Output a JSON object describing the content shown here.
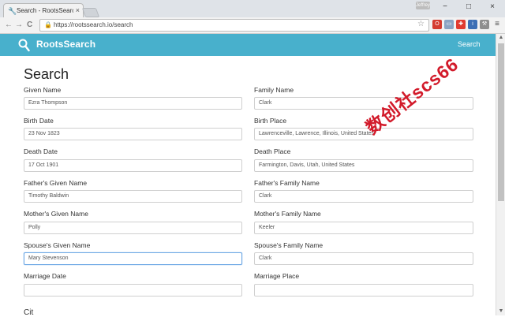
{
  "browser": {
    "tab_title": "Search - RootsSearch",
    "tab_favicon": "wrench-icon",
    "url": "https://rootssearch.io/search",
    "user_badge": "Jeffrey",
    "back_glyph": "←",
    "forward_glyph": "→",
    "reload_glyph": "C",
    "menu_glyph": "≡"
  },
  "app": {
    "brand": "RootsSearch",
    "nav_search": "Search"
  },
  "page": {
    "title": "Search",
    "bottom_heading": "Cit"
  },
  "form": {
    "given_name": {
      "label": "Given Name",
      "value": "Ezra Thompson"
    },
    "family_name": {
      "label": "Family Name",
      "value": "Clark"
    },
    "birth_date": {
      "label": "Birth Date",
      "value": "23 Nov 1823"
    },
    "birth_place": {
      "label": "Birth Place",
      "value": "Lawrenceville, Lawrence, Illinois, United States"
    },
    "death_date": {
      "label": "Death Date",
      "value": "17 Oct 1901"
    },
    "death_place": {
      "label": "Death Place",
      "value": "Farmington, Davis, Utah, United States"
    },
    "father_given": {
      "label": "Father's Given Name",
      "value": "Timothy Baldwin"
    },
    "father_family": {
      "label": "Father's Family Name",
      "value": "Clark"
    },
    "mother_given": {
      "label": "Mother's Given Name",
      "value": "Polly"
    },
    "mother_family": {
      "label": "Mother's Family Name",
      "value": "Keeler"
    },
    "spouse_given": {
      "label": "Spouse's Given Name",
      "value": "Mary Stevenson"
    },
    "spouse_family": {
      "label": "Spouse's Family Name",
      "value": "Clark"
    },
    "marriage_date": {
      "label": "Marriage Date",
      "value": ""
    },
    "marriage_place": {
      "label": "Marriage Place",
      "value": ""
    }
  },
  "watermark": "数创社scs66",
  "colors": {
    "header": "#48b0cc",
    "watermark": "#d21a2a",
    "focus_border": "#6ea8e5"
  }
}
